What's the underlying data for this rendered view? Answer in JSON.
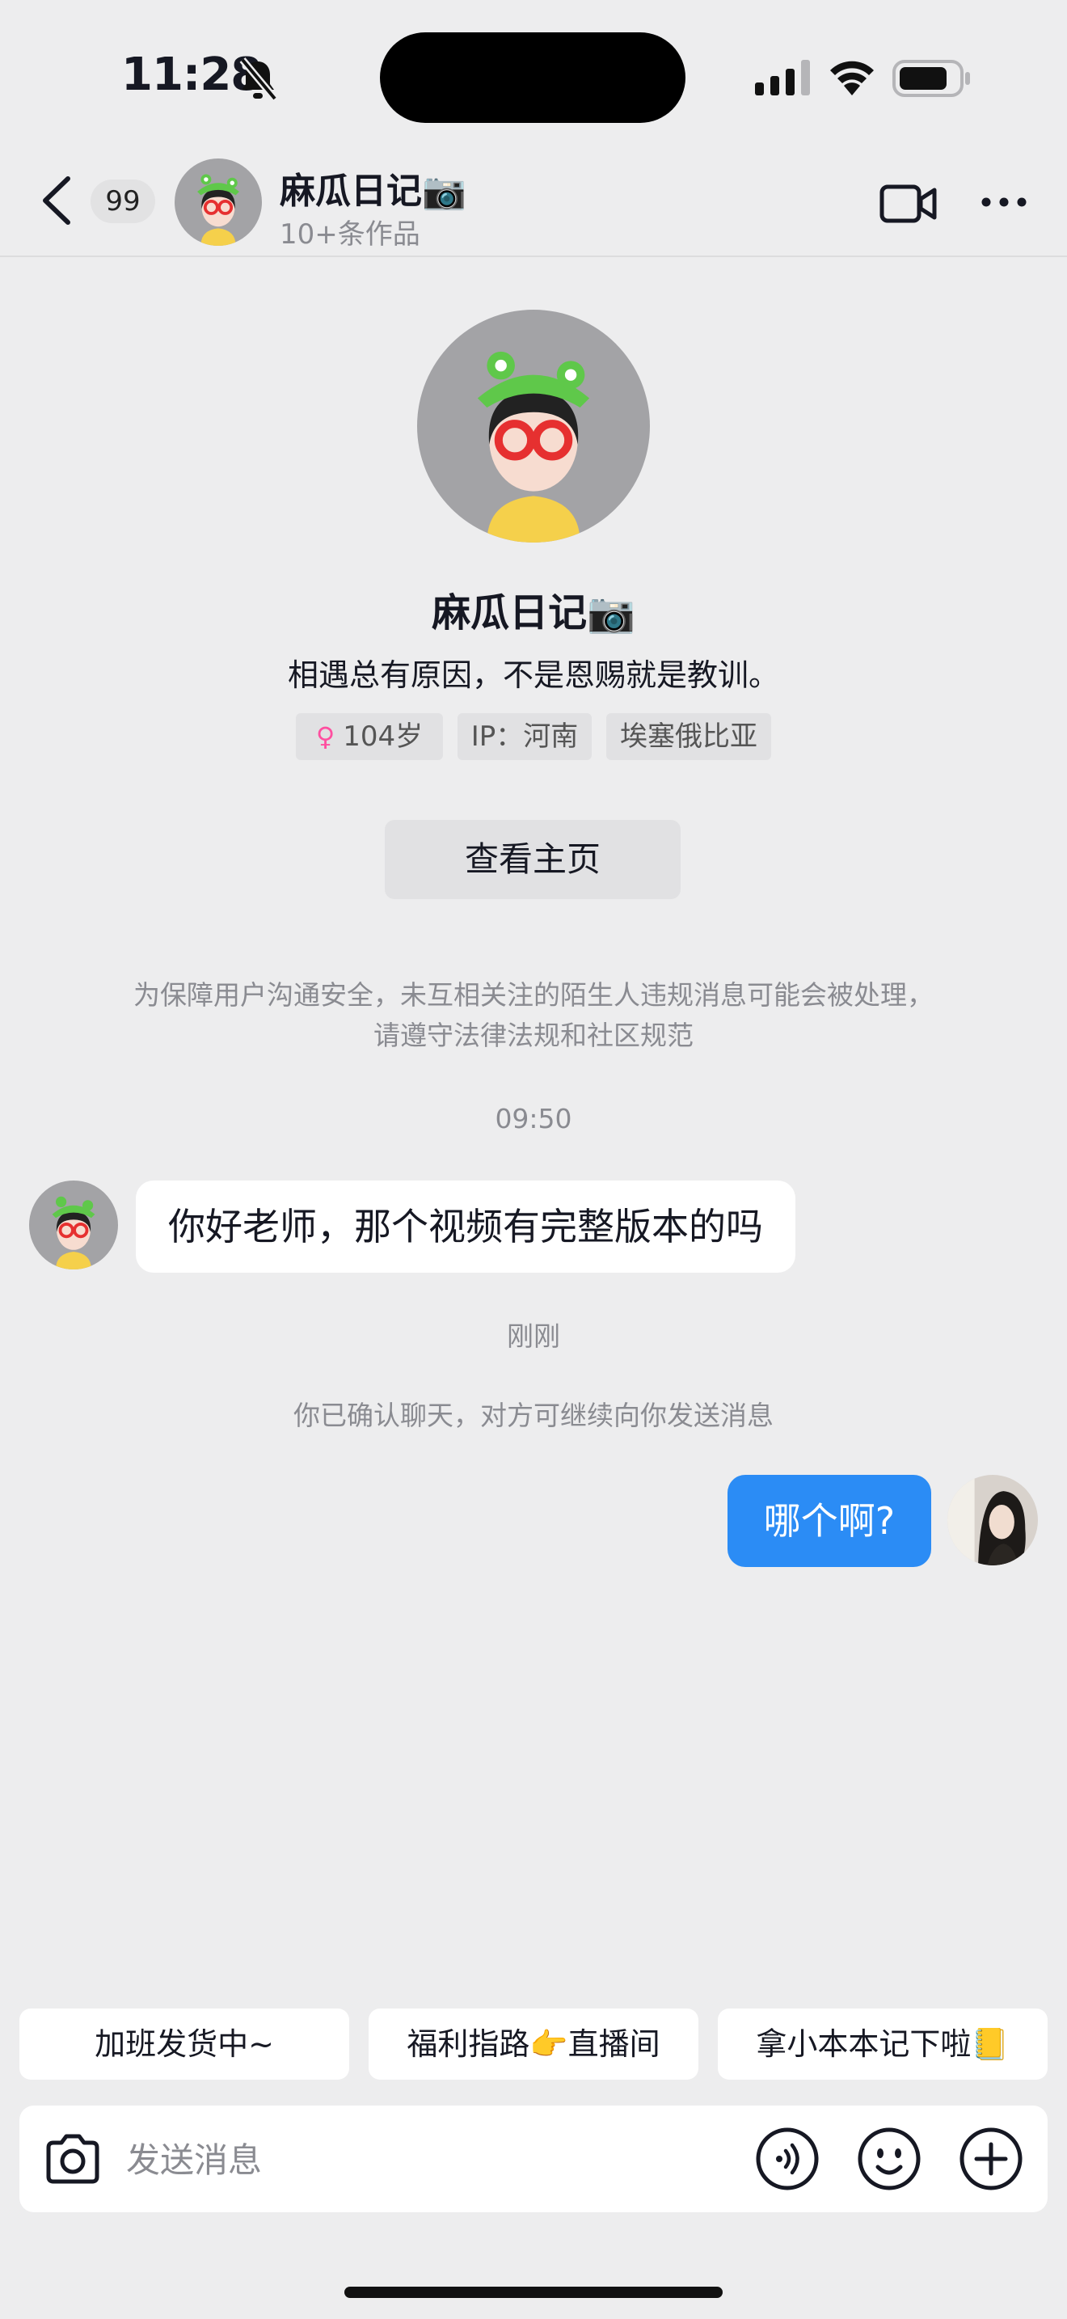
{
  "status_bar": {
    "time": "11:28"
  },
  "header": {
    "unread_count": "99",
    "name": "麻瓜日记📷",
    "subtitle": "10+条作品"
  },
  "profile": {
    "name": "麻瓜日记📷",
    "bio": "相遇总有原因，不是恩赐就是教训。",
    "tags": {
      "age": "104岁",
      "ip": "IP：河南",
      "location": "埃塞俄比亚"
    },
    "view_homepage": "查看主页"
  },
  "chat": {
    "safety_notice": "为保障用户沟通安全，未互相关注的陌生人违规消息可能会被处理，请遵守法律法规和社区规范",
    "timestamp_1": "09:50",
    "incoming_message": "你好老师，那个视频有完整版本的吗",
    "timestamp_2": "刚刚",
    "system_message": "你已确认聊天，对方可继续向你发送消息",
    "outgoing_message": "哪个啊?"
  },
  "quick_replies": [
    "加班发货中~",
    "福利指路👉直播间",
    "拿小本本记下啦📒"
  ],
  "composer": {
    "placeholder": "发送消息"
  },
  "icons": [
    "bell-muted-icon",
    "signal-icon",
    "wifi-icon",
    "battery-icon",
    "back-arrow-icon",
    "video-call-icon",
    "more-icon",
    "camera-icon",
    "voice-icon",
    "emoji-icon",
    "plus-icon"
  ],
  "colors": {
    "accent_blue": "#2b8cf5",
    "background": "#ededee",
    "gender_pink": "#ff4fa0"
  }
}
